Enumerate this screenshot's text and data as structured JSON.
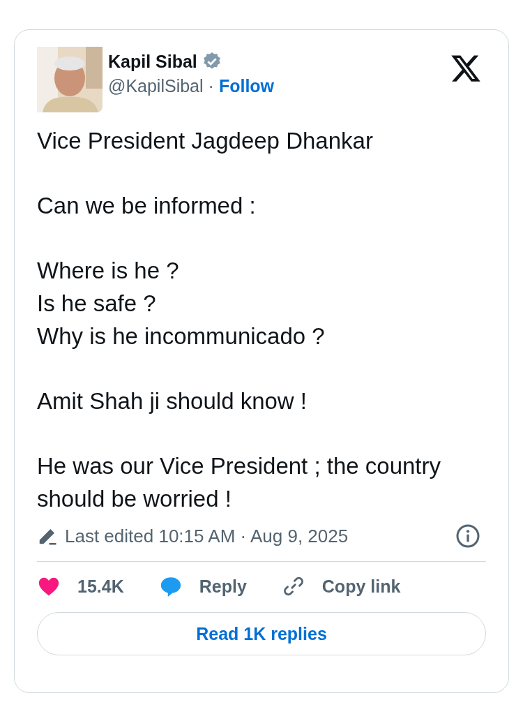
{
  "author": {
    "name": "Kapil Sibal",
    "verified": true,
    "handle": "@KapilSibal",
    "separator": "·",
    "follow": "Follow"
  },
  "paragraphs": [
    [
      "Vice President Jagdeep Dhankar"
    ],
    [
      "Can we be informed :"
    ],
    [
      "Where is he ?",
      "Is he safe ?",
      "Why is he incommunicado ?"
    ],
    [
      "Amit Shah ji should know !"
    ],
    [
      "He was our Vice President ; the country should be worried !"
    ]
  ],
  "edited": "Last edited 10:15 AM · Aug 9, 2025",
  "actions": [
    {
      "kind": "like",
      "label": "15.4K"
    },
    {
      "kind": "reply",
      "label": "Reply"
    },
    {
      "kind": "copy",
      "label": "Copy link"
    }
  ],
  "read_replies": "Read 1K replies"
}
